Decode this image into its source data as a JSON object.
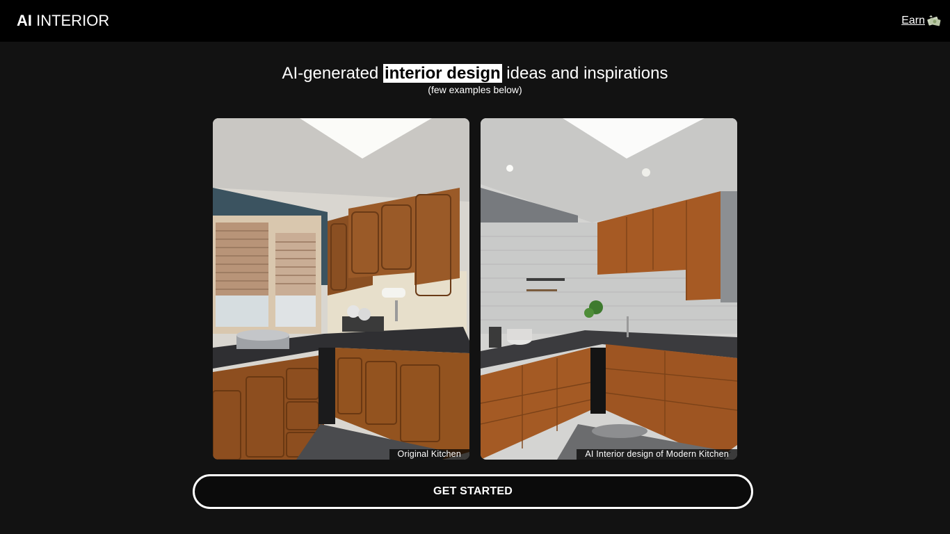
{
  "header": {
    "logo_bold": "AI",
    "logo_rest": " INTERIOR",
    "earn_label": "Earn",
    "earn_icon": "money-icon"
  },
  "hero": {
    "headline_before": "AI-generated ",
    "headline_highlight": "interior design",
    "headline_after": " ideas and inspirations",
    "subline": "(few examples below)"
  },
  "examples": [
    {
      "caption": "Original Kitchen"
    },
    {
      "caption": "AI Interior design of Modern Kitchen"
    }
  ],
  "cta": {
    "label": "GET STARTED"
  },
  "colors": {
    "background": "#121212",
    "header_background": "#000000",
    "text": "#ffffff",
    "highlight_background": "#ffffff",
    "highlight_text": "#000000"
  }
}
